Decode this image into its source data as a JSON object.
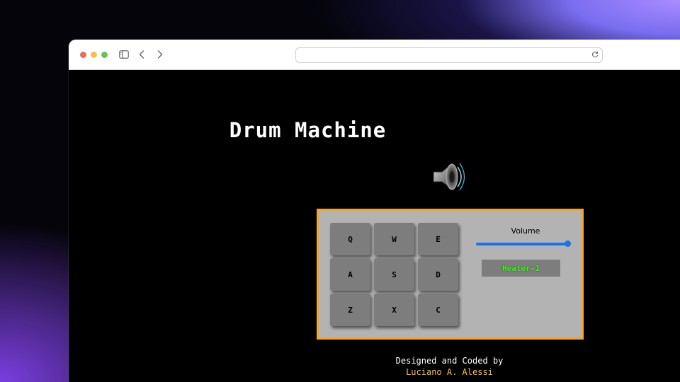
{
  "browser": {
    "url": "",
    "icons": [
      "sidebar-icon",
      "back-icon",
      "forward-icon",
      "reload-icon"
    ]
  },
  "app": {
    "title": "Drum Machine",
    "speaker_icon": "speaker-icon",
    "border_color": "#f5a623",
    "pads": [
      {
        "key": "Q"
      },
      {
        "key": "W"
      },
      {
        "key": "E"
      },
      {
        "key": "A"
      },
      {
        "key": "S"
      },
      {
        "key": "D"
      },
      {
        "key": "Z"
      },
      {
        "key": "X"
      },
      {
        "key": "C"
      }
    ],
    "volume": {
      "label": "Volume",
      "value": 1.0,
      "accent": "#1a73e8"
    },
    "display_text": "Heater-1",
    "display_color": "#39ff14"
  },
  "footer": {
    "line1": "Designed and Coded by",
    "author": "Luciano A. Alessi",
    "author_color": "#f5c04f"
  }
}
